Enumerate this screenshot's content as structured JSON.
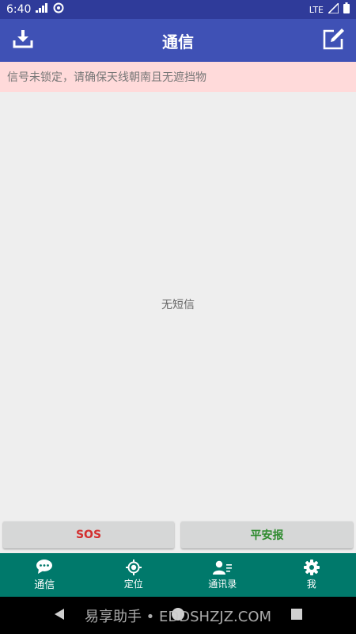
{
  "status_bar": {
    "time": "6:40",
    "network": "LTE"
  },
  "app_bar": {
    "title": "通信",
    "left_icon": "download-icon",
    "right_icon": "compose-icon"
  },
  "banner": {
    "text": "信号未锁定，请确保天线朝南且无遮挡物"
  },
  "content": {
    "empty_text": "无短信"
  },
  "actions": {
    "sos_label": "SOS",
    "safe_label": "平安报"
  },
  "bottom_nav": {
    "items": [
      {
        "label": "通信",
        "icon": "chat-bubble-icon",
        "active": true
      },
      {
        "label": "定位",
        "icon": "locate-icon",
        "active": false
      },
      {
        "label": "通讯录",
        "icon": "contacts-icon",
        "active": false
      },
      {
        "label": "我",
        "icon": "gear-icon",
        "active": false
      }
    ]
  },
  "watermark": {
    "text": "易享助手 • EDDSHZJZ.COM"
  },
  "colors": {
    "status_bar": "#2f3b9a",
    "app_bar": "#3f51b5",
    "banner_bg": "#ffdada",
    "bottom_nav": "#00796b",
    "sos_text": "#d32f2f",
    "safe_text": "#2e8b2e"
  }
}
